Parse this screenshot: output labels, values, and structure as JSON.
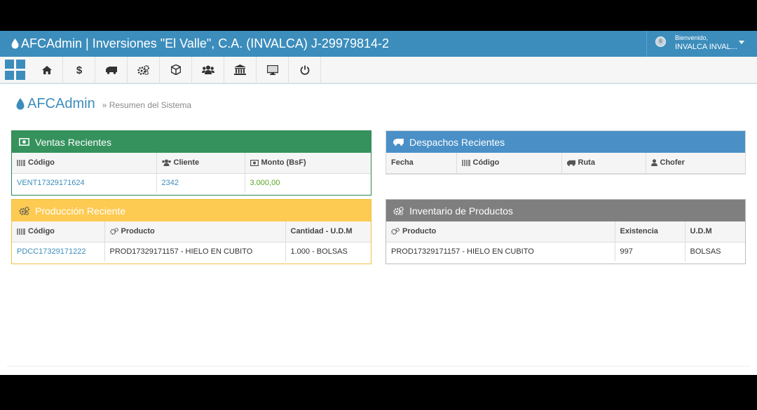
{
  "header": {
    "title": "AFCAdmin | Inversiones \"El Valle\", C.A. (INVALCA) J-29979814-2",
    "welcome": "Bienvenido,",
    "user": "INVALCA INVAL..."
  },
  "toolbar": {
    "items": [
      "home-icon",
      "dollar-icon",
      "truck-icon",
      "cogs-icon",
      "cube-icon",
      "users-icon",
      "bank-icon",
      "monitor-icon",
      "power-icon"
    ]
  },
  "page": {
    "title": "AFCAdmin",
    "breadcrumb": "Resumen del Sistema"
  },
  "ventas": {
    "title": "Ventas Recientes",
    "headers": [
      "Código",
      "Cliente",
      "Monto (BsF)"
    ],
    "rows": [
      [
        "VENT17329171624",
        "2342",
        "3.000,00"
      ]
    ],
    "color": "#35925d"
  },
  "despachos": {
    "title": "Despachos Recientes",
    "headers": [
      "Fecha",
      "Código",
      "Ruta",
      "Chofer"
    ],
    "color": "#4a90c7"
  },
  "produccion": {
    "title": "Producción Reciente",
    "headers": [
      "Código",
      "Producto",
      "Cantidad - U.D.M"
    ],
    "rows": [
      [
        "PDCC17329171222",
        "PROD17329171157 - HIELO EN CUBITO",
        "1.000 - BOLSAS"
      ]
    ],
    "color": "#fdca52"
  },
  "inventario": {
    "title": "Inventario de Productos",
    "headers": [
      "Producto",
      "Existencia",
      "U.D.M"
    ],
    "rows": [
      [
        "PROD17329171157 - HIELO EN CUBITO",
        "997",
        "BOLSAS"
      ]
    ],
    "color": "#7f7f7f"
  }
}
